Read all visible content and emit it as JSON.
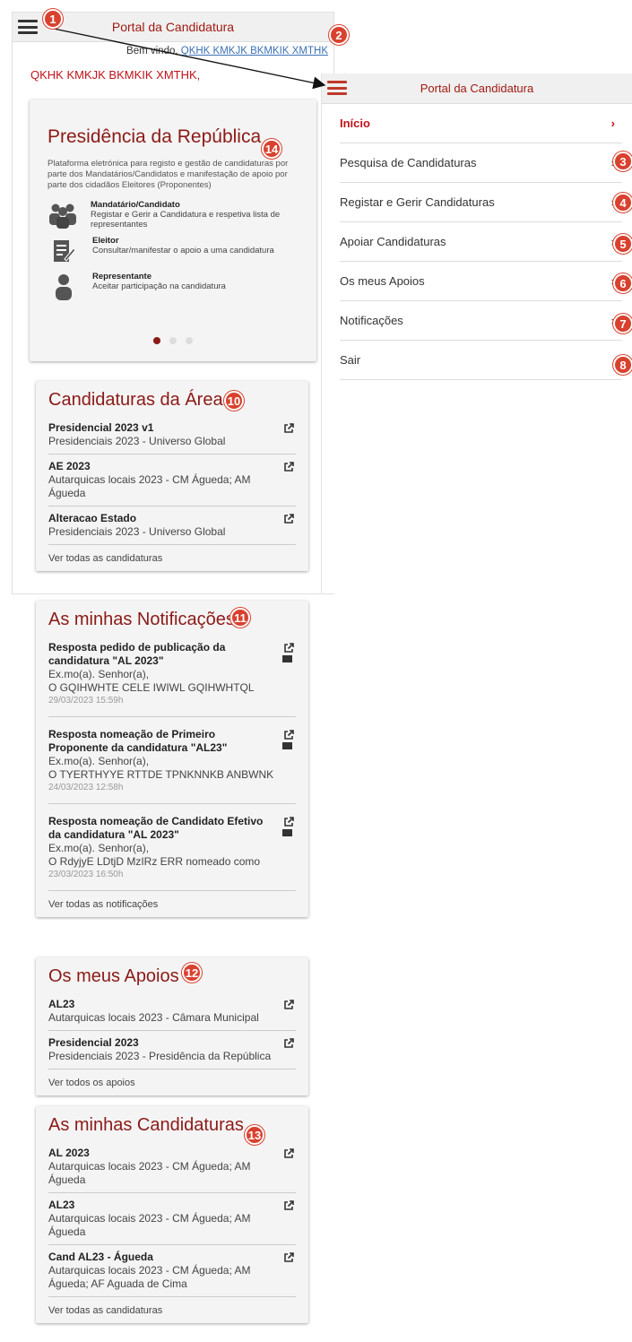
{
  "app": {
    "title": "Portal da Candidatura"
  },
  "welcome": {
    "prefix": "Bem vindo,",
    "user_link": "QKHK KMKJK BKMKIK XMTHK"
  },
  "username_heading": "QKHK KMKJK BKMKIK XMTHK,",
  "carousel": {
    "title": "Presidência da República",
    "description": "Plataforma eletrónica para registo e gestão de candidaturas por parte dos Mandatários/Candidatos e manifestação de apoio por parte dos cidadãos Eleitores (Proponentes)",
    "roles": [
      {
        "name": "Mandatário/Candidato",
        "desc": "Registar e Gerir a Candidatura e respetiva lista de representantes",
        "icon": "group-icon"
      },
      {
        "name": "Eleitor",
        "desc": "Consultar/manifestar o apoio a uma candidatura",
        "icon": "form-edit-icon"
      },
      {
        "name": "Representante",
        "desc": "Aceitar participação na candidatura",
        "icon": "person-icon"
      }
    ]
  },
  "area_candidaturas": {
    "title": "Candidaturas da Área",
    "items": [
      {
        "title": "Presidencial 2023 v1",
        "sub": "Presidenciais 2023 - Universo Global"
      },
      {
        "title": "AE 2023",
        "sub": "Autarquicas locais 2023 - CM Águeda; AM Águeda"
      },
      {
        "title": "Alteracao Estado",
        "sub": "Presidenciais 2023 - Universo Global"
      }
    ],
    "more": "Ver todas as candidaturas"
  },
  "notificacoes": {
    "title": "As minhas Notificações",
    "items": [
      {
        "title": "Resposta pedido de publicação da candidatura \"AL 2023\"",
        "greet": "Ex.mo(a). Senhor(a),",
        "body": "O GQIHWHTE CELE IWIWL GQIHWHTQL",
        "date": "29/03/2023 15:59h"
      },
      {
        "title": "Resposta nomeação de Primeiro Proponente da candidatura \"AL23\"",
        "greet": "Ex.mo(a). Senhor(a),",
        "body": "O TYERTHYYE RTTDE TPNKNNKB ANBWNK",
        "date": "24/03/2023 12:58h"
      },
      {
        "title": "Resposta nomeação de Candidato Efetivo da candidatura \"AL 2023\"",
        "greet": "Ex.mo(a). Senhor(a),",
        "body": "O RdyjyE LDtjD MzIRz ERR nomeado como",
        "date": "23/03/2023 16:50h"
      }
    ],
    "more": "Ver todas as notificações"
  },
  "apoios": {
    "title": "Os meus Apoios",
    "items": [
      {
        "title": "AL23",
        "sub": "Autarquicas locais 2023 - Câmara Municipal"
      },
      {
        "title": "Presidencial 2023",
        "sub": "Presidenciais 2023 - Presidência da República"
      }
    ],
    "more": "Ver todos os apoios"
  },
  "minhas_candidaturas": {
    "title": "As minhas Candidaturas",
    "items": [
      {
        "title": "AL 2023",
        "sub": "Autarquicas locais 2023 - CM Águeda; AM Águeda"
      },
      {
        "title": "AL23",
        "sub": "Autarquicas locais 2023 - CM Águeda; AM Águeda"
      },
      {
        "title": "Cand AL23 - Águeda",
        "sub": "Autarquicas locais 2023 - CM Águeda; AM Águeda; AF Aguada de Cima"
      }
    ],
    "more": "Ver todas as candidaturas"
  },
  "menu": {
    "items": [
      {
        "label": "Início",
        "chev": "›"
      },
      {
        "label": "Pesquisa de Candidaturas",
        "chev": "›"
      },
      {
        "label": "Registar e Gerir Candidaturas",
        "chev": "›"
      },
      {
        "label": "Apoiar Candidaturas",
        "chev": "›"
      },
      {
        "label": "Os meus Apoios",
        "chev": "›"
      },
      {
        "label": "Notificações",
        "chev": "›"
      },
      {
        "label": "Sair",
        "chev": ""
      }
    ]
  },
  "badges": [
    "1",
    "2",
    "3",
    "4",
    "5",
    "6",
    "7",
    "8",
    "10",
    "11",
    "12",
    "13",
    "14"
  ],
  "colors": {
    "brand": "#8b1a17",
    "accent": "#c0121a",
    "badge": "#d9412f"
  }
}
